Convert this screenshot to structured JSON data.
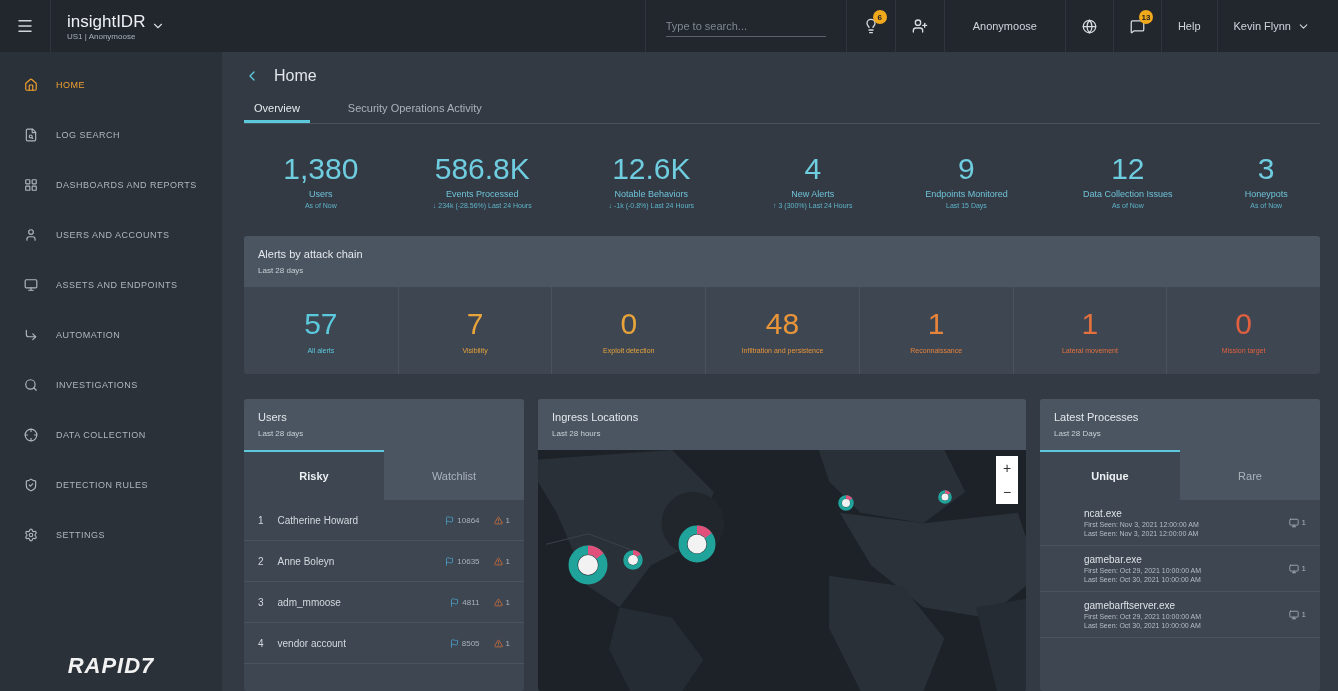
{
  "topbar": {
    "product": "insightIDR",
    "org": "US1 | Anonymoose",
    "search": {
      "placeholder": "Type to search..."
    },
    "lightbulb_badge": "6",
    "org_button": "Anonymoose",
    "notifications_badge": "13",
    "help": "Help",
    "user": "Kevin Flynn"
  },
  "sidebar": {
    "items": [
      {
        "label": "HOME",
        "selected": true
      },
      {
        "label": "LOG SEARCH",
        "selected": false
      },
      {
        "label": "DASHBOARDS AND REPORTS",
        "selected": false
      },
      {
        "label": "USERS AND ACCOUNTS",
        "selected": false
      },
      {
        "label": "ASSETS AND ENDPOINTS",
        "selected": false
      },
      {
        "label": "AUTOMATION",
        "selected": false
      },
      {
        "label": "INVESTIGATIONS",
        "selected": false
      },
      {
        "label": "DATA COLLECTION",
        "selected": false
      },
      {
        "label": "DETECTION RULES",
        "selected": false
      },
      {
        "label": "SETTINGS",
        "selected": false
      }
    ],
    "logo": "RAPID7"
  },
  "page": {
    "title": "Home",
    "tabs": [
      {
        "label": "Overview",
        "selected": true
      },
      {
        "label": "Security Operations Activity",
        "selected": false
      }
    ]
  },
  "stats": [
    {
      "value": "1,380",
      "label": "Users",
      "note": "As of Now"
    },
    {
      "value": "586.8K",
      "label": "Events Processed",
      "note": "↓ 234k (-28.56%)  Last 24 Hours"
    },
    {
      "value": "12.6K",
      "label": "Notable Behaviors",
      "note": "↓ -1k (-0.8%)  Last 24 Hours"
    },
    {
      "value": "4",
      "label": "New Alerts",
      "note": "↑ 3 (300%)  Last 24 Hours"
    },
    {
      "value": "9",
      "label": "Endpoints Monitored",
      "note": "Last 15 Days"
    },
    {
      "value": "12",
      "label": "Data Collection Issues",
      "note": "As of Now"
    },
    {
      "value": "3",
      "label": "Honeypots",
      "note": "As of Now"
    }
  ],
  "attack_chain": {
    "title": "Alerts by attack chain",
    "subtitle": "Last 28 days",
    "stages": [
      {
        "value": "57",
        "label": "All alerts",
        "color": "#5bc8dc"
      },
      {
        "value": "7",
        "label": "Visibility",
        "color": "#e8a33a"
      },
      {
        "value": "0",
        "label": "Exploit detection",
        "color": "#e8a33a"
      },
      {
        "value": "48",
        "label": "Infiltration and persistence",
        "color": "#e8953a"
      },
      {
        "value": "1",
        "label": "Reconnaissance",
        "color": "#e8833a"
      },
      {
        "value": "1",
        "label": "Lateral movement",
        "color": "#e4703e"
      },
      {
        "value": "0",
        "label": "Mission target",
        "color": "#e0603f"
      }
    ]
  },
  "users_panel": {
    "title": "Users",
    "subtitle": "Last 28 days",
    "tabs": [
      {
        "label": "Risky",
        "selected": true
      },
      {
        "label": "Watchlist",
        "selected": false
      }
    ],
    "rows": [
      {
        "rank": "1",
        "name": "Catherine Howard",
        "flags": "10864",
        "alerts": "1"
      },
      {
        "rank": "2",
        "name": "Anne Boleyn",
        "flags": "10635",
        "alerts": "1"
      },
      {
        "rank": "3",
        "name": "adm_mmoose",
        "flags": "4811",
        "alerts": "1"
      },
      {
        "rank": "4",
        "name": "vendor account",
        "flags": "8505",
        "alerts": "1"
      }
    ]
  },
  "ingress_panel": {
    "title": "Ingress Locations",
    "subtitle": "Last 28 hours",
    "map": {
      "kind": "picture",
      "zoom_in": "+",
      "zoom_out": "−"
    }
  },
  "processes_panel": {
    "title": "Latest Processes",
    "subtitle": "Last 28 Days",
    "tabs": [
      {
        "label": "Unique",
        "selected": true
      },
      {
        "label": "Rare",
        "selected": false
      }
    ],
    "rows": [
      {
        "name": "ncat.exe",
        "first_seen": "First Seen: Nov 3, 2021 12:00:00 AM",
        "last_seen": "Last Seen: Nov 3, 2021 12:00:00 AM",
        "count": "1"
      },
      {
        "name": "gamebar.exe",
        "first_seen": "First Seen: Oct 29, 2021 10:00:00 AM",
        "last_seen": "Last Seen: Oct 30, 2021 10:00:00 AM",
        "count": "1"
      },
      {
        "name": "gamebarftserver.exe",
        "first_seen": "First Seen: Oct 29, 2021 10:00:00 AM",
        "last_seen": "Last Seen: Oct 30, 2021 10:00:00 AM",
        "count": "1"
      }
    ]
  }
}
